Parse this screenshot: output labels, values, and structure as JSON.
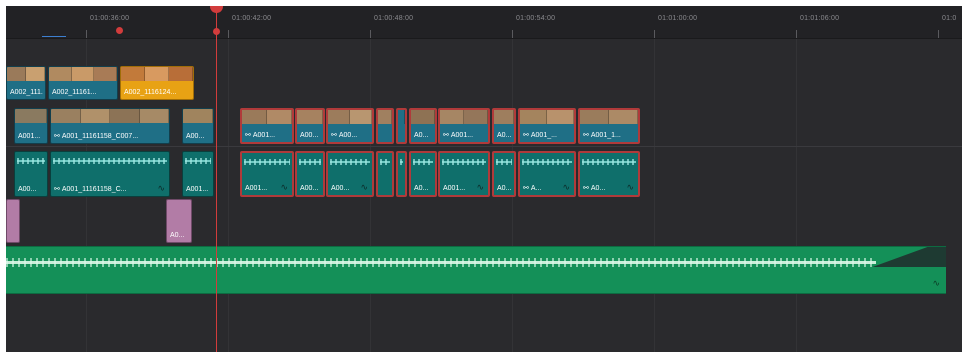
{
  "timeline": {
    "timecodes": [
      "01:00:36:00",
      "01:00:42:00",
      "01:00:48:00",
      "01:00:54:00",
      "01:01:00:00",
      "01:01:06:00",
      "01:0"
    ],
    "clip_labels": {
      "v2_1": "A002_111...",
      "v2_2": "A002_11161...",
      "v2_3": "A002_1116124...",
      "v1_1": "A001...",
      "v1_2": "A001_11161158_C007...",
      "v1_3": "A00...",
      "v1_4": "A001...",
      "v1_5": "A00...",
      "v1_6": "A00...",
      "v1_7": "A0...",
      "v1_8": "A001...",
      "v1_9": "A0...",
      "v1_10": "A001_...",
      "v1_11": "A001_1...",
      "a1_1": "A00...",
      "a1_2": "A001_11161158_C...",
      "a1_3": "A001...",
      "a1_4": "A001...",
      "a1_5": "A00...",
      "a1_6": "A00...",
      "a1_7": "A0...",
      "a1_8": "A001...",
      "a1_9": "A0...",
      "a1_10": "A...",
      "a1_11": "A0...",
      "p_1": "A0..."
    },
    "icons": {
      "link": "link-icon",
      "curve": "curve-icon"
    },
    "colors": {
      "playhead": "#d23c3c",
      "video_clip": "#1f6f86",
      "selected_clip": "#e8a214",
      "audio_clip": "#0f6f6b",
      "music_track": "#149058",
      "pink_clip": "#b27ca6"
    }
  }
}
